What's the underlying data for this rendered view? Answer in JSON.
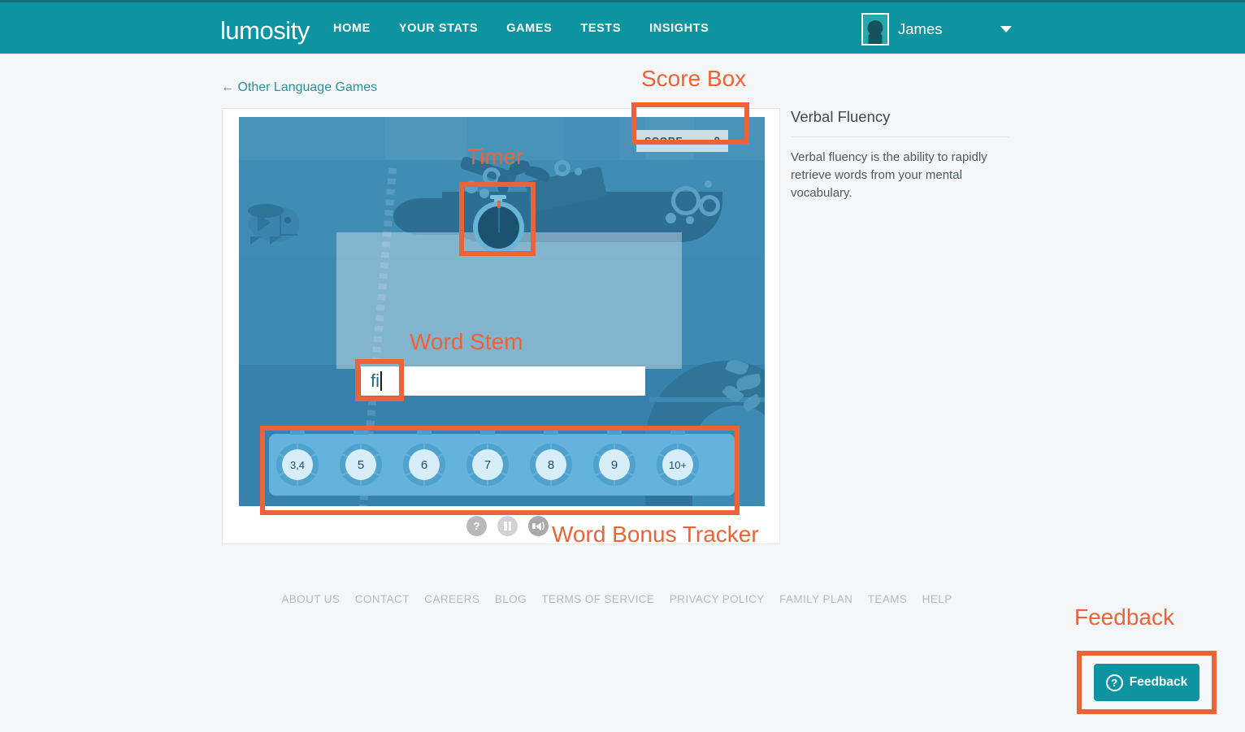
{
  "nav": {
    "brand": "lumosity",
    "links": [
      "HOME",
      "YOUR STATS",
      "GAMES",
      "TESTS",
      "INSIGHTS"
    ],
    "user": {
      "name": "James",
      "avatar_icon": "person-head-icon",
      "caret_icon": "chevron-down-icon"
    }
  },
  "back_link": {
    "label": "← Other Language Games"
  },
  "game": {
    "score": {
      "label": "SCORE",
      "value": "0"
    },
    "word_stem": {
      "value": "fi",
      "placeholder": ""
    },
    "tracker": {
      "tokens": [
        "3,4",
        "5",
        "6",
        "7",
        "8",
        "9",
        "10+"
      ]
    },
    "controls": [
      {
        "name": "help-icon",
        "glyph": "?"
      },
      {
        "name": "pause-icon",
        "glyph": "||"
      },
      {
        "name": "sound-icon",
        "glyph": "speaker"
      }
    ],
    "timer": {
      "name": "stopwatch-timer"
    }
  },
  "info": {
    "title": "Verbal Fluency",
    "description": "Verbal fluency is the ability to rapidly retrieve words from your mental vocabulary."
  },
  "footer": {
    "links": [
      "ABOUT US",
      "CONTACT",
      "CAREERS",
      "BLOG",
      "TERMS OF SERVICE",
      "PRIVACY POLICY",
      "FAMILY PLAN",
      "TEAMS",
      "HELP"
    ]
  },
  "feedback": {
    "label": "Feedback",
    "icon": "question-circle-icon"
  },
  "annotations": {
    "score_box": "Score Box",
    "timer": "Timer",
    "word_stem": "Word Stem",
    "word_bonus_tracker": "Word Bonus Tracker",
    "feedback": "Feedback",
    "color": "#ec6338"
  },
  "colors": {
    "brand_teal": "#0e94a0",
    "page_bg": "#f4f6f8",
    "annotation_orange": "#ec6338",
    "water_blue": "#3d8ab3"
  }
}
